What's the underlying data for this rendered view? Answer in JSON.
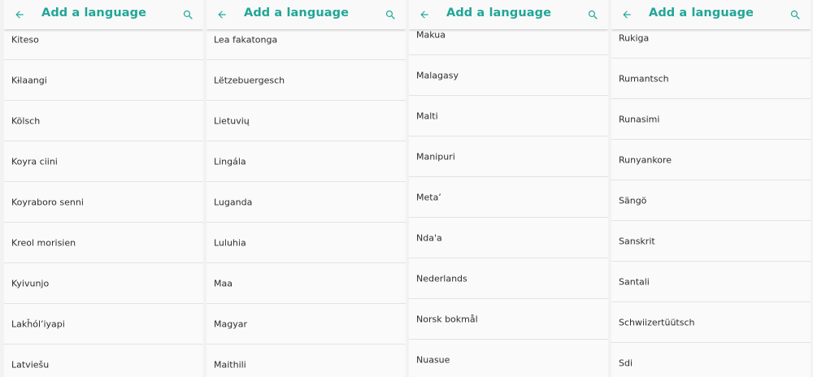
{
  "theme": {
    "accent": "#21a698",
    "text": "#2d2d2d",
    "divider": "#e3e3e3",
    "background": "#fafafa"
  },
  "panels": [
    {
      "header": {
        "title": "Add a language",
        "back_icon": "arrow-left-icon",
        "search_icon": "search-icon"
      },
      "items": [
        {
          "label": "Kiteso"
        },
        {
          "label": "Kɨlaangi"
        },
        {
          "label": "Kölsch"
        },
        {
          "label": "Koyra ciini"
        },
        {
          "label": "Koyraboro senni"
        },
        {
          "label": "Kreol morisien"
        },
        {
          "label": "Kyivunjo"
        },
        {
          "label": "Lakȟól’iyapi"
        },
        {
          "label": "Latviešu"
        }
      ]
    },
    {
      "header": {
        "title": "Add a language",
        "back_icon": "arrow-left-icon",
        "search_icon": "search-icon"
      },
      "items": [
        {
          "label": "Lea fakatonga"
        },
        {
          "label": "Lëtzebuergesch"
        },
        {
          "label": "Lietuvių"
        },
        {
          "label": "Lingála"
        },
        {
          "label": "Luganda"
        },
        {
          "label": "Luluhia"
        },
        {
          "label": "Maa"
        },
        {
          "label": "Magyar"
        },
        {
          "label": "Maithili"
        }
      ]
    },
    {
      "header": {
        "title": "Add a language",
        "back_icon": "arrow-left-icon",
        "search_icon": "search-icon"
      },
      "items": [
        {
          "label": "Makua"
        },
        {
          "label": "Malagasy"
        },
        {
          "label": "Malti"
        },
        {
          "label": "Manipuri"
        },
        {
          "label": "Metaʼ"
        },
        {
          "label": "Ndaꞌa"
        },
        {
          "label": "Nederlands"
        },
        {
          "label": "Norsk bokmål"
        },
        {
          "label": "Nuasue"
        }
      ]
    },
    {
      "header": {
        "title": "Add a language",
        "back_icon": "arrow-left-icon",
        "search_icon": "search-icon"
      },
      "items": [
        {
          "label": "Rukiga"
        },
        {
          "label": "Rumantsch"
        },
        {
          "label": "Runasimi"
        },
        {
          "label": "Runyankore"
        },
        {
          "label": "Sängö"
        },
        {
          "label": "Sanskrit"
        },
        {
          "label": "Santali"
        },
        {
          "label": "Schwiizertüütsch"
        },
        {
          "label": "Sdi"
        }
      ]
    }
  ]
}
